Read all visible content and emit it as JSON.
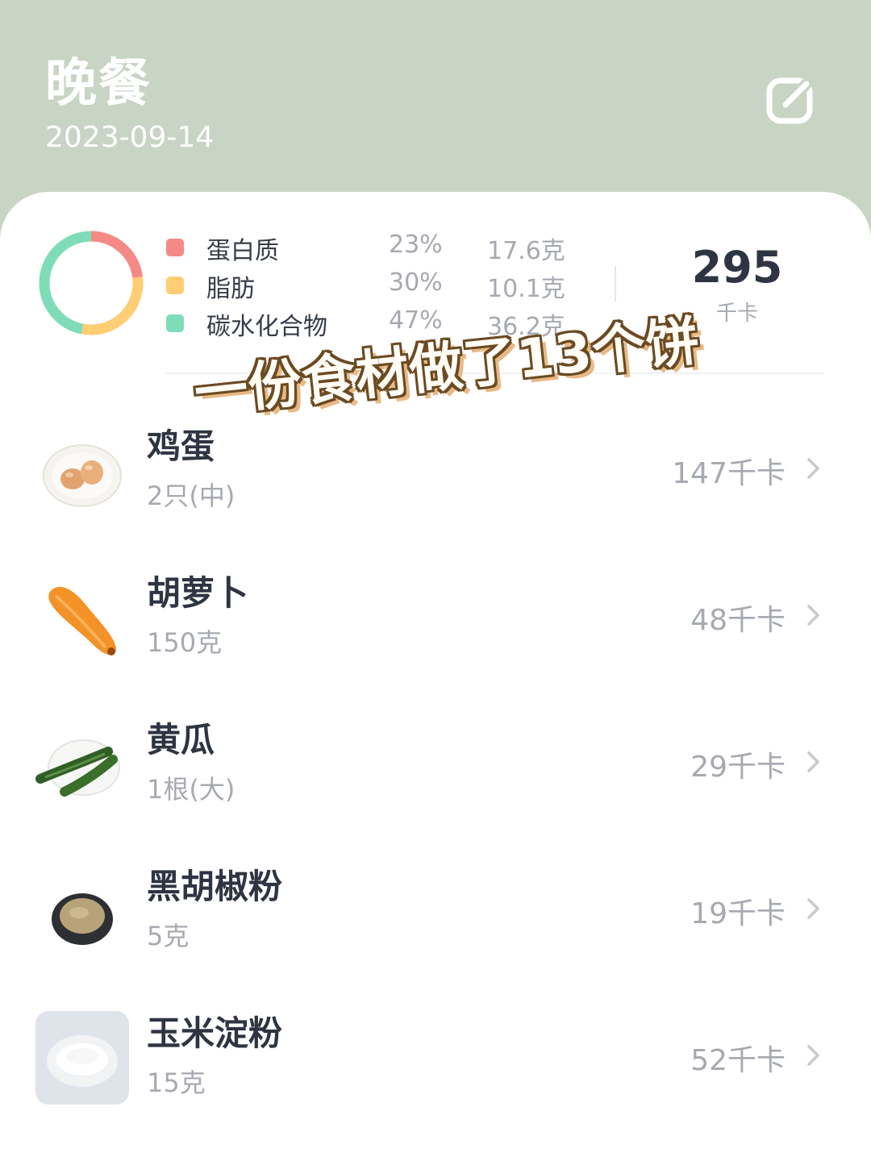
{
  "header": {
    "title": "晚餐",
    "date": "2023-09-14",
    "edit_icon": "edit-icon"
  },
  "summary": {
    "nutrients": [
      {
        "name": "蛋白质",
        "percent": "23%",
        "amount": "17.6克",
        "color": "#f48a86",
        "share": 0.23
      },
      {
        "name": "脂肪",
        "percent": "30%",
        "amount": "10.1克",
        "color": "#ffcd73",
        "share": 0.3
      },
      {
        "name": "碳水化合物",
        "percent": "47%",
        "amount": "36.2克",
        "color": "#7fdcb8",
        "share": 0.47
      }
    ],
    "total_kcal": "295",
    "total_unit": "千卡"
  },
  "overlay": {
    "sticker_text": "一份食材做了13个饼"
  },
  "foods": [
    {
      "name": "鸡蛋",
      "portion": "2只(中)",
      "kcal": "147千卡",
      "icon": "egg-plate-icon"
    },
    {
      "name": "胡萝卜",
      "portion": "150克",
      "kcal": "48千卡",
      "icon": "carrot-icon"
    },
    {
      "name": "黄瓜",
      "portion": "1根(大)",
      "kcal": "29千卡",
      "icon": "cucumber-icon"
    },
    {
      "name": "黑胡椒粉",
      "portion": "5克",
      "kcal": "19千卡",
      "icon": "pepper-bowl-icon"
    },
    {
      "name": "玉米淀粉",
      "portion": "15克",
      "kcal": "52千卡",
      "icon": "cornstarch-icon"
    }
  ],
  "colors": {
    "header_bg": "#c9d5c4",
    "text_primary": "#2e3442",
    "text_secondary": "#a6a9b0"
  }
}
